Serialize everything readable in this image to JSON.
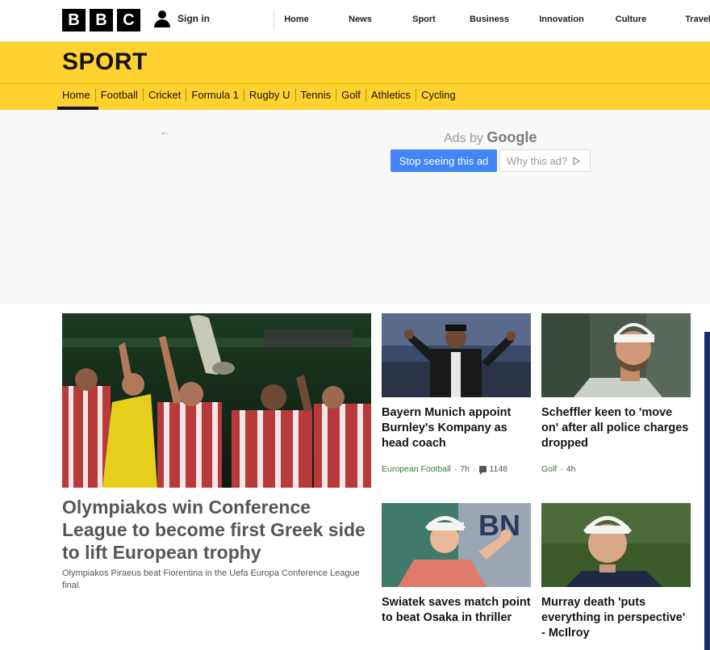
{
  "header": {
    "logo_letters": [
      "B",
      "B",
      "C"
    ],
    "signin_label": "Sign in",
    "nav": [
      "Home",
      "News",
      "Sport",
      "Business",
      "Innovation",
      "Culture",
      "Travel"
    ]
  },
  "sport": {
    "title": "SPORT",
    "subnav": [
      "Home",
      "Football",
      "Cricket",
      "Formula 1",
      "Rugby U",
      "Tennis",
      "Golf",
      "Athletics",
      "Cycling"
    ],
    "active_subnav": "Home"
  },
  "ad": {
    "ads_by": "Ads by",
    "google": "Google",
    "stop_label": "Stop seeing this ad",
    "why_label": "Why this ad?"
  },
  "hero": {
    "title": "Olympiakos win Conference League to become first Greek side to lift European trophy",
    "summary": "Olympiakos Piraeus beat Fiorentina in the Uefa Europa Conference League final."
  },
  "cards": [
    {
      "title": "Bayern Munich appoint Burnley's Kompany as head coach",
      "topic": "European Football",
      "time": "7h",
      "comments": "1148"
    },
    {
      "title": "Scheffler keen to 'move on' after all police charges dropped",
      "topic": "Golf",
      "time": "4h"
    },
    {
      "title": "Swiatek saves match point to beat Osaka in thriller"
    },
    {
      "title": "Murray death 'puts everything in perspective' - McIlroy"
    }
  ],
  "colors": {
    "sport_yellow": "#ffd230",
    "google_blue": "#4285f4",
    "topic_green": "#2e7d32"
  }
}
